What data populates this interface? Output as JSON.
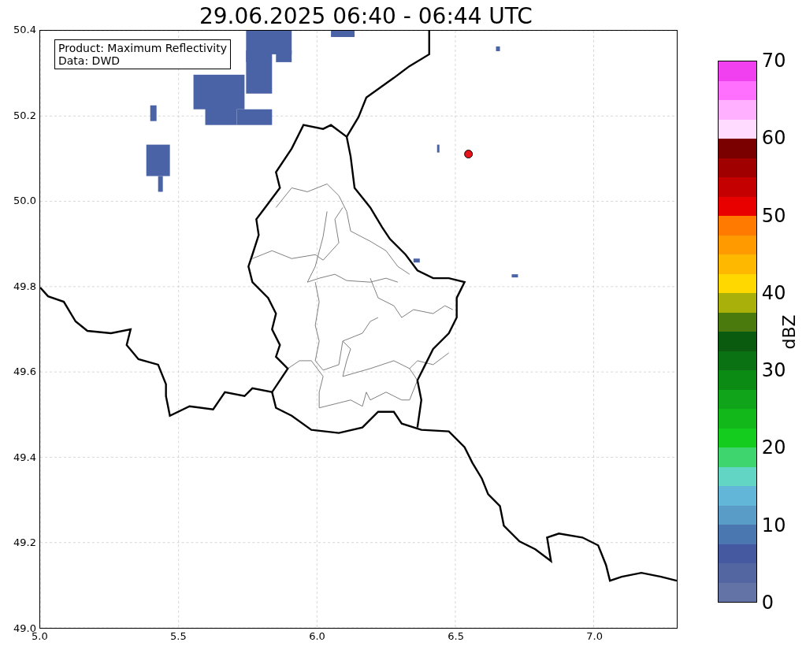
{
  "title": "29.06.2025 06:40 - 06:44 UTC",
  "info_box": {
    "lines": [
      "Product: Maximum Reflectivity",
      "Data: DWD"
    ]
  },
  "map": {
    "x_ticks": [
      "5.0",
      "5.5",
      "6.0",
      "6.5",
      "7.0"
    ],
    "y_ticks": [
      "50.4",
      "50.2",
      "50.0",
      "49.8",
      "49.6",
      "49.4",
      "49.2",
      "49.0"
    ]
  },
  "colorbar": {
    "label": "dBZ",
    "ticks": [
      "70",
      "60",
      "50",
      "40",
      "30",
      "20",
      "10",
      "0"
    ],
    "segments": [
      {
        "color": "#6373a6"
      },
      {
        "color": "#5366a2"
      },
      {
        "color": "#4459a0"
      },
      {
        "color": "#4a77b0"
      },
      {
        "color": "#5a9cc8"
      },
      {
        "color": "#62b6d8"
      },
      {
        "color": "#62d5c5"
      },
      {
        "color": "#3ed46e"
      },
      {
        "color": "#14cc1e"
      },
      {
        "color": "#12b81a"
      },
      {
        "color": "#0fa41a"
      },
      {
        "color": "#0b8a14"
      },
      {
        "color": "#0a7212"
      },
      {
        "color": "#0a5a10"
      },
      {
        "color": "#4a7a0e"
      },
      {
        "color": "#aab00a"
      },
      {
        "color": "#ffd800"
      },
      {
        "color": "#ffb800"
      },
      {
        "color": "#ff9a00"
      },
      {
        "color": "#ff7a00"
      },
      {
        "color": "#e80000"
      },
      {
        "color": "#c40000"
      },
      {
        "color": "#a00000"
      },
      {
        "color": "#7a0000"
      },
      {
        "color": "#ffdcff"
      },
      {
        "color": "#ffb0ff"
      },
      {
        "color": "#ff70ff"
      },
      {
        "color": "#f040f0"
      }
    ]
  }
}
